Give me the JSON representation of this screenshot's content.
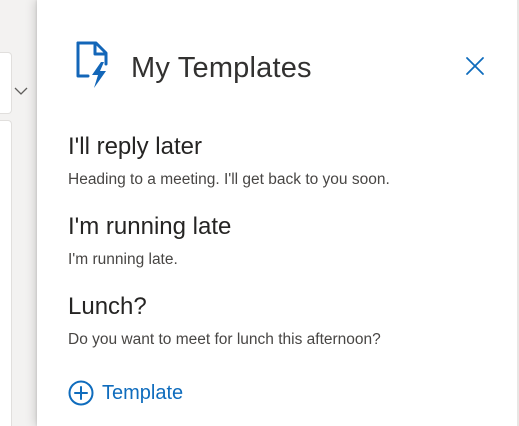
{
  "panel": {
    "title": "My Templates",
    "logo_icon": "templates-doc-lightning-icon",
    "close_icon": "close-icon",
    "accent_color": "#0f6cbd"
  },
  "templates": [
    {
      "title": "I'll reply later",
      "body": "Heading to a meeting. I'll get back to you soon."
    },
    {
      "title": "I'm running late",
      "body": "I'm running late."
    },
    {
      "title": "Lunch?",
      "body": "Do you want to meet for lunch this afternoon?"
    }
  ],
  "actions": {
    "add_template_label": "Template",
    "add_icon": "plus-circle-icon"
  }
}
